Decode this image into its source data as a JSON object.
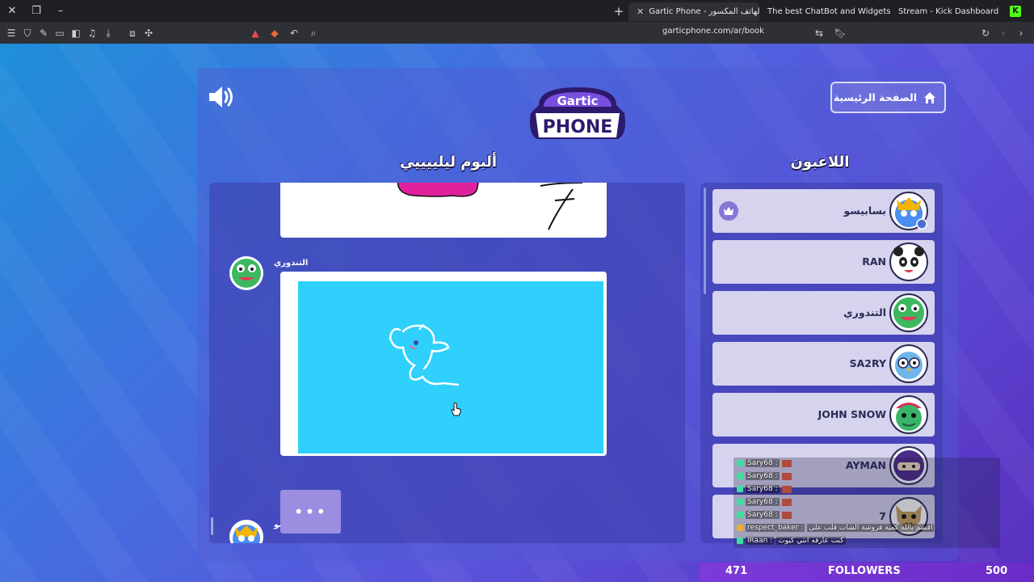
{
  "browser": {
    "tabs": [
      {
        "title": "Gartic Phone - لعبة الهاتف المكسور",
        "active": true
      },
      {
        "title": "The best ChatBot and Widgets for Kick"
      },
      {
        "title": "Stream - Kick Dashboard"
      }
    ],
    "url": "garticphone.com/ar/book"
  },
  "header": {
    "logo_top": "Gartic",
    "logo_bottom": "PHONE",
    "home_label": "الصفحة الرئيسية"
  },
  "album": {
    "title": "ألبوم ليلييييي",
    "entries": [
      {
        "author": "التندوري"
      },
      {
        "author": "بسابيسو",
        "typing": "•••"
      }
    ]
  },
  "players": {
    "title": "اللاعبون",
    "list": [
      {
        "name": "بسابيسو",
        "host": true
      },
      {
        "name": "RAN"
      },
      {
        "name": "التندوري"
      },
      {
        "name": "SA2RY"
      },
      {
        "name": "JOHN SNOW"
      },
      {
        "name": "AYMAN"
      },
      {
        "name": "7"
      }
    ]
  },
  "chat": {
    "lines": [
      {
        "user": "Sary68 :"
      },
      {
        "user": "Sary68 :"
      },
      {
        "user": "Sary68 :"
      },
      {
        "user": "Sary68 :"
      },
      {
        "user": "Sary68 :"
      },
      {
        "user": "respect_baker :",
        "text": "اقسم بالله كمية فروشة الشات قلب على"
      },
      {
        "user": "lRaan :",
        "text": "كنت عارفه انتي كيوت"
      }
    ]
  },
  "followers": {
    "current": "471",
    "label": "FOLLOWERS",
    "goal": "500"
  }
}
